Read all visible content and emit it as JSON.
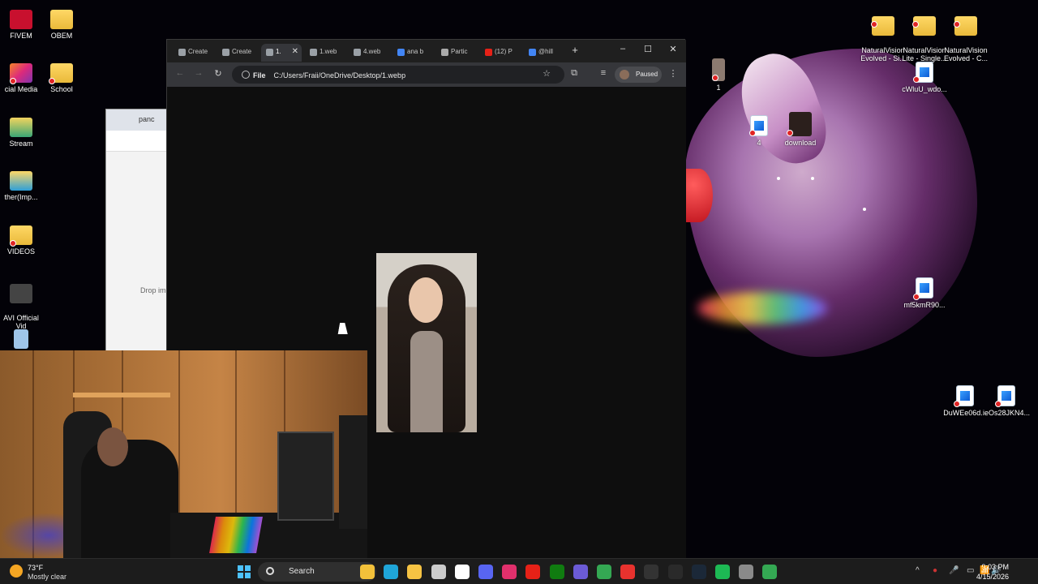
{
  "desktop": {
    "left_icons": [
      {
        "label": "FIVEM",
        "kind": "app"
      },
      {
        "label": "OBEM",
        "kind": "folder"
      },
      {
        "label": "cial Media",
        "kind": "app"
      },
      {
        "label": "School",
        "kind": "folder"
      },
      {
        "label": "Stream",
        "kind": "app"
      },
      {
        "label": "ther(Imp...",
        "kind": "app"
      },
      {
        "label": "VIDEOS",
        "kind": "folder"
      },
      {
        "label": "AVI Official\nVid",
        "kind": "app"
      }
    ],
    "right_icons": [
      {
        "label": "NaturalVision\nEvolved - Si...",
        "kind": "folder"
      },
      {
        "label": "NaturalVision\nLite - Single...",
        "kind": "folder"
      },
      {
        "label": "NaturalVision\nEvolved - C...",
        "kind": "folder"
      },
      {
        "label": "1",
        "kind": "image"
      },
      {
        "label": "cWluU_wdo...",
        "kind": "image"
      },
      {
        "label": "4",
        "kind": "image"
      },
      {
        "label": "download",
        "kind": "image"
      },
      {
        "label": "mf5kmR90...",
        "kind": "image"
      },
      {
        "label": "DuWEe06d...",
        "kind": "image"
      },
      {
        "label": "ieOs28JKN4...",
        "kind": "image"
      }
    ]
  },
  "bg_window": {
    "search_text": "panc",
    "drop_text": "Drop im"
  },
  "browser": {
    "tabs": [
      {
        "label": "Create",
        "active": false
      },
      {
        "label": "Create",
        "active": false
      },
      {
        "label": "1.",
        "active": true
      },
      {
        "label": "1.web",
        "active": false
      },
      {
        "label": "4.web",
        "active": false
      },
      {
        "label": "ana b",
        "active": false
      },
      {
        "label": "Partic",
        "active": false
      },
      {
        "label": "(12) P",
        "active": false
      },
      {
        "label": "@hill",
        "active": false
      }
    ],
    "new_tab_glyph": "+",
    "window_controls": {
      "minimize": "–",
      "maximize": "☐",
      "close": "✕"
    },
    "omnibox": {
      "scheme_label": "File",
      "url": "C:/Users/Fraii/OneDrive/Desktop/1.webp"
    },
    "profile_status": "Paused",
    "menu_glyph": "⋮"
  },
  "taskbar": {
    "weather": {
      "temp": "73°F",
      "condition": "Mostly clear"
    },
    "search_label": "Search",
    "apps": [
      {
        "icon": "folder-icon",
        "color": "#f3c13a"
      },
      {
        "icon": "edge-icon",
        "color": "#1fa5d8"
      },
      {
        "icon": "explorer-icon",
        "color": "#f6c343"
      },
      {
        "icon": "chatgpt-icon",
        "color": "#cccccc"
      },
      {
        "icon": "tiktok-icon",
        "color": "#ffffff"
      },
      {
        "icon": "discord-icon",
        "color": "#5865f2"
      },
      {
        "icon": "instagram-icon",
        "color": "#e1306c"
      },
      {
        "icon": "youtube-icon",
        "color": "#e62117"
      },
      {
        "icon": "xbox-icon",
        "color": "#107c10"
      },
      {
        "icon": "grid-app-icon",
        "color": "#6b5bd6"
      },
      {
        "icon": "chrome-icon",
        "color": "#34a853"
      },
      {
        "icon": "adobe-icon",
        "color": "#e8322e"
      },
      {
        "icon": "callofduty-icon",
        "color": "#333333"
      },
      {
        "icon": "epic-icon",
        "color": "#2a2a2a"
      },
      {
        "icon": "steam-icon",
        "color": "#1b2838"
      },
      {
        "icon": "spotify-icon",
        "color": "#1db954"
      },
      {
        "icon": "settings-icon",
        "color": "#8a8a8a"
      },
      {
        "icon": "chrome-active-icon",
        "color": "#34a853"
      }
    ],
    "tray_glyphs": [
      "^",
      "●",
      "🎤",
      "▭",
      "📶",
      "🔊"
    ],
    "time": "9:03 PM",
    "date": "4/15/2026"
  },
  "colors": {
    "accent": "#4cc2ff",
    "browser_bg": "#0e0e0e",
    "taskbar_bg": "#1c1c1c"
  }
}
